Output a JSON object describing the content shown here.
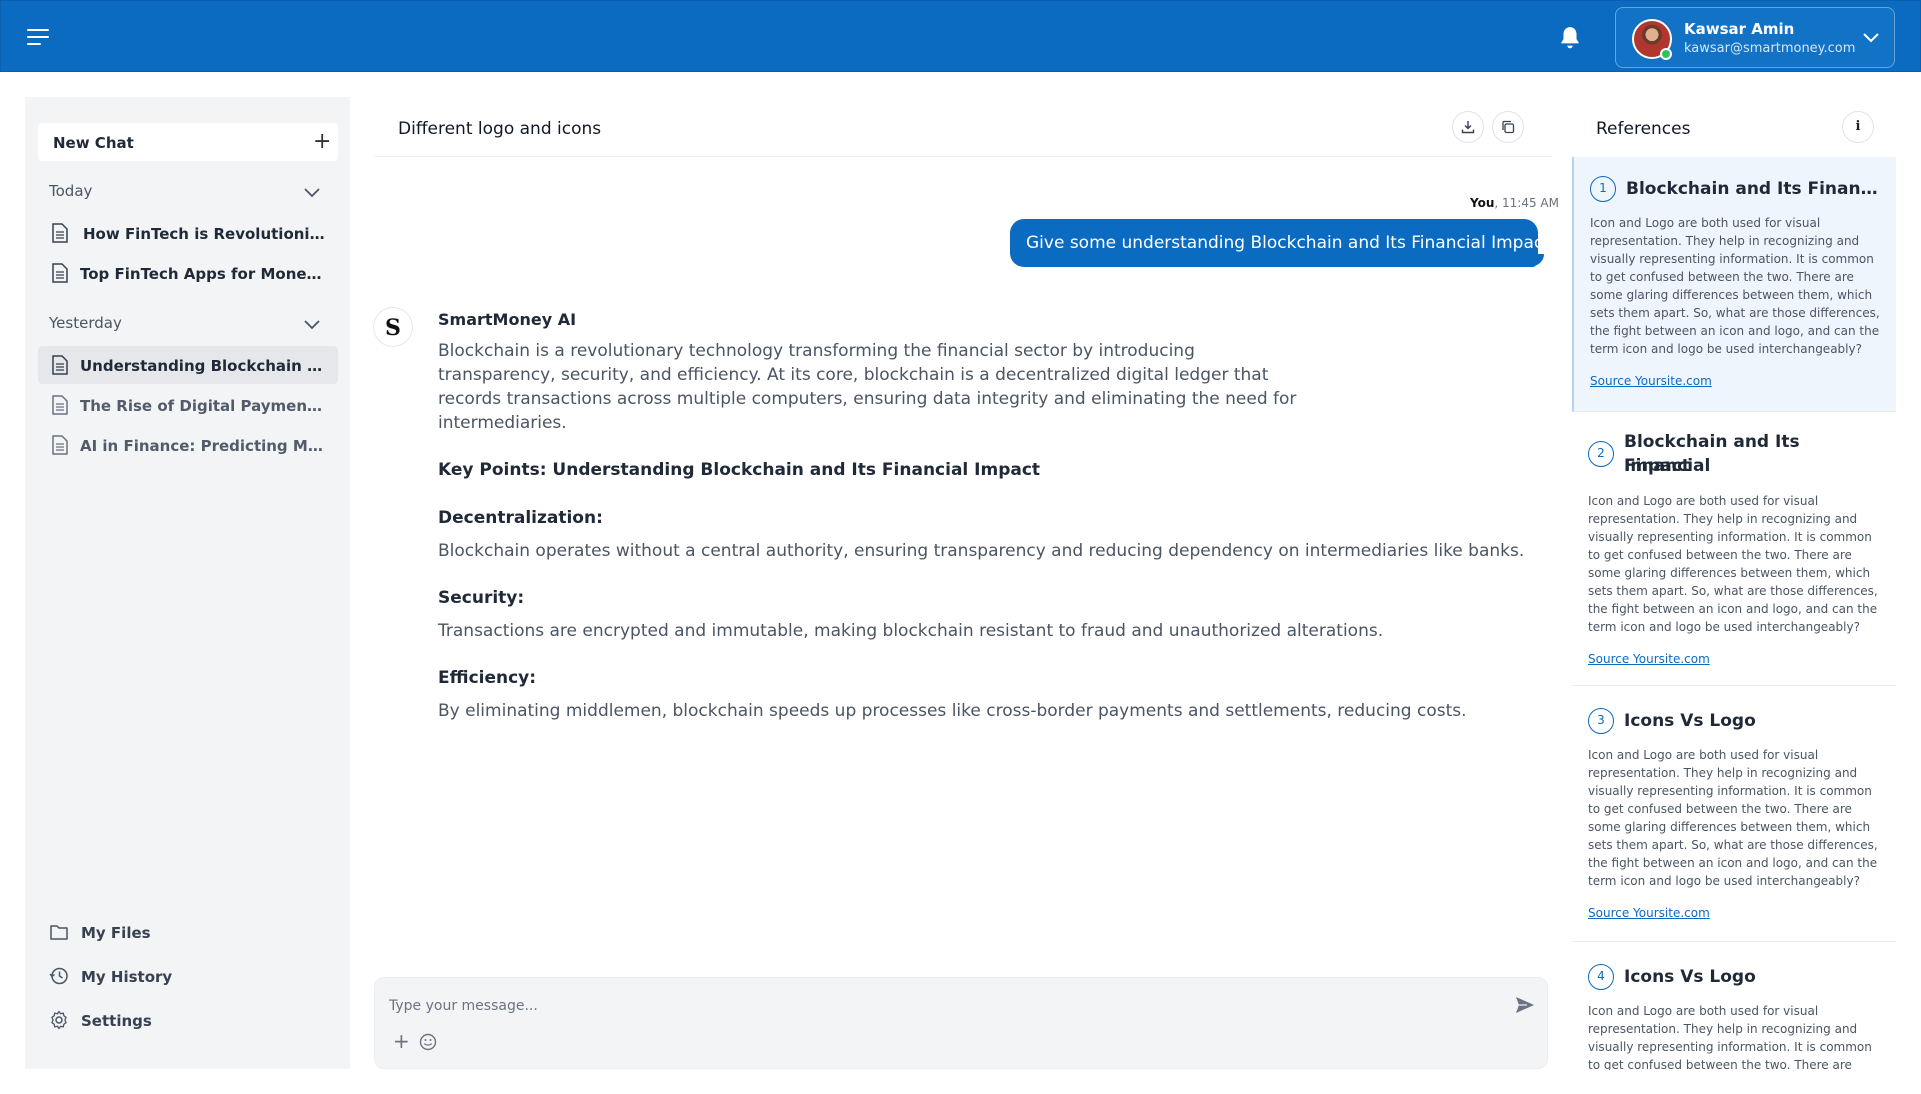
{
  "topbar": {
    "user_name": "Kawsar Amin",
    "user_email": "kawsar@smartmoney.com"
  },
  "sidebar": {
    "new_chat_label": "New Chat",
    "today_label": "Today",
    "today_items": [
      "How FinTech is Revolutionizing B...",
      "Top FinTech Apps for Money Man..."
    ],
    "yesterday_label": "Yesterday",
    "yesterday_items": [
      "Understanding Blockchain and It...",
      "The Rise of Digital Payments and...",
      "AI in Finance: Predicting Market T..."
    ],
    "bottom": {
      "files": "My Files",
      "history": "My History",
      "settings": "Settings"
    }
  },
  "chat": {
    "title": "Different logo and icons",
    "user_sender": "You",
    "user_time": ", 11:45 AM",
    "user_message": "Give some understanding Blockchain and Its Financial Impact",
    "ai_name": "SmartMoney AI",
    "ai_intro_lines": [
      "Blockchain is a revolutionary technology transforming the financial sector by introducing",
      "transparency, security, and efficiency. At its core, blockchain is a decentralized digital ledger that",
      "records transactions across multiple computers, ensuring data integrity and eliminating the need for",
      "intermediaries."
    ],
    "key_points_heading": "Key Points: Understanding Blockchain and Its Financial Impact",
    "points": [
      {
        "heading": "Decentralization:",
        "text": "Blockchain operates without a central authority, ensuring transparency and reducing dependency on intermediaries like banks."
      },
      {
        "heading": "Security:",
        "text": "Transactions are encrypted and immutable, making blockchain resistant to fraud and unauthorized alterations."
      },
      {
        "heading": "Efficiency:",
        "text": "By eliminating middlemen, blockchain speeds up processes like cross-border payments and settlements, reducing costs."
      }
    ],
    "composer_placeholder": "Type your message..."
  },
  "references": {
    "title": "References",
    "source_label": "Source Yoursite.com",
    "body_lines": [
      "Icon and Logo are both used for visual",
      "representation. They help in recognizing and",
      "visually representing information. It is common",
      "to get confused between the two. There are",
      "some glaring differences between them, which",
      "sets them apart. So, what are those differences,",
      "the fight between an icon and logo, and can the",
      "term icon and logo be used interchangeably?"
    ],
    "items": [
      {
        "num": "1",
        "title": "Blockchain and Its Financial I...",
        "title2": ""
      },
      {
        "num": "2",
        "title": "Blockchain and Its Financial",
        "title2": "Impact"
      },
      {
        "num": "3",
        "title": "Icons Vs Logo",
        "title2": ""
      },
      {
        "num": "4",
        "title": "Icons Vs Logo",
        "title2": ""
      }
    ]
  },
  "colors": {
    "brand": "#0b6bc0",
    "sidebar_bg": "#f3f4f6"
  }
}
